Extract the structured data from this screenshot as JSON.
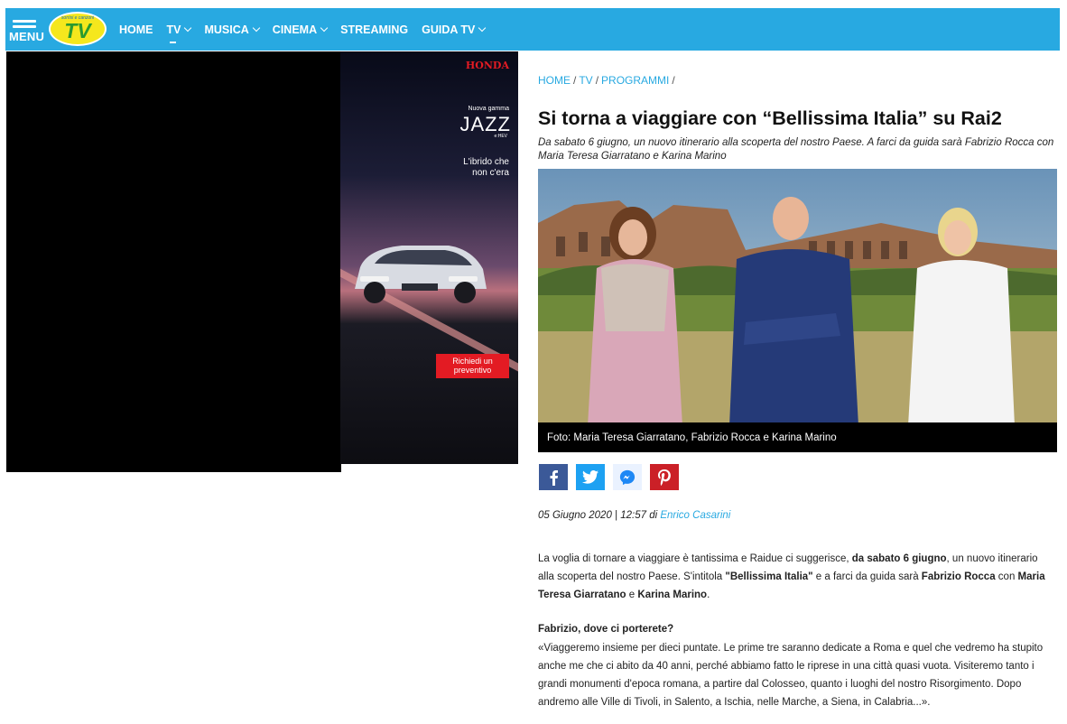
{
  "nav": {
    "menu_label": "MENU",
    "logo_tag": "sorrisi e canzoni",
    "logo_text": "TV",
    "items": [
      {
        "label": "HOME",
        "dropdown": false
      },
      {
        "label": "TV",
        "dropdown": true
      },
      {
        "label": "MUSICA",
        "dropdown": true
      },
      {
        "label": "CINEMA",
        "dropdown": true
      },
      {
        "label": "STREAMING",
        "dropdown": false
      },
      {
        "label": "GUIDA TV",
        "dropdown": true
      }
    ]
  },
  "ad": {
    "brand": "HONDA",
    "line1": "Nuova gamma",
    "model": "JAZZ",
    "variant": "e:HEV",
    "tagline1": "L'ibrido che",
    "tagline2": "non c'era",
    "cta1": "Richiedi un",
    "cta2": "preventivo"
  },
  "breadcrumb": [
    "HOME",
    "TV",
    "PROGRAMMI"
  ],
  "article": {
    "title": "Si torna a viaggiare con “Bellissima Italia” su Rai2",
    "subtitle": "Da sabato 6 giugno, un nuovo itinerario alla scoperta del nostro Paese. A farci da guida sarà Fabrizio Rocca con Maria Teresa Giarratano e Karina Marino",
    "caption": "Foto: Maria Teresa Giarratano, Fabrizio Rocca e Karina Marino",
    "date": "05 Giugno 2020 | 12:57 di",
    "author": "Enrico Casarini",
    "p1": {
      "a": "La voglia di tornare a viaggiare è tantissima e Raidue ci suggerisce, ",
      "b": "da sabato 6 giugno",
      "c": ", un nuovo itinerario alla scoperta del nostro Paese. S'intitola ",
      "d": "\"Bellissima Italia\"",
      "e": " e a farci da guida sarà ",
      "f": "Fabrizio Rocca",
      "g": " con ",
      "h": "Maria Teresa Giarratano",
      "i": " e ",
      "j": "Karina Marino",
      "k": "."
    },
    "question": "Fabrizio, dove ci porterete?",
    "p2": "«Viaggeremo insieme per dieci puntate. Le prime tre saranno dedicate a Roma e quel che vedremo ha stupito anche me che ci abito da 40 anni, perché abbiamo fatto le riprese in una città quasi vuota. Visiteremo tanto i grandi monumenti d'epoca romana, a partire dal Colosseo, quanto i luoghi del nostro Risorgimento. Dopo andremo alle Ville di Tivoli, in Salento, a Ischia, nelle Marche, a Siena, in Calabria...»."
  },
  "share": [
    "facebook-icon",
    "twitter-icon",
    "messenger-icon",
    "pinterest-icon"
  ],
  "colors": {
    "nav_bg": "#28a9e1",
    "link": "#28a9e1",
    "honda_red": "#e31b23"
  }
}
